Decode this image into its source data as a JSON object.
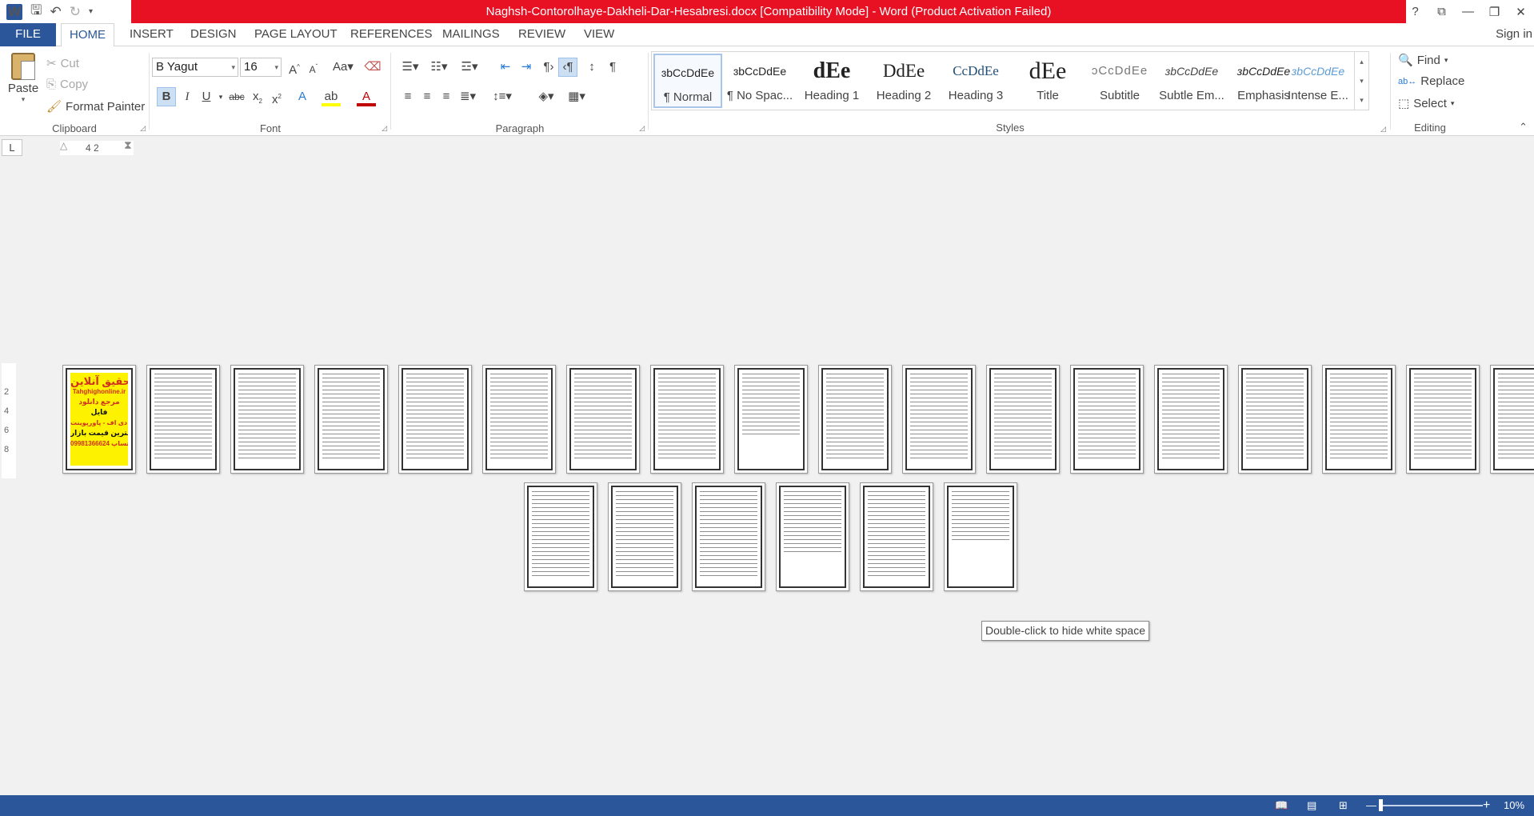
{
  "window": {
    "title": "Naghsh-Contorolhaye-Dakheli-Dar-Hesabresi.docx [Compatibility Mode]  -  Word (Product Activation Failed)",
    "controls": [
      "?",
      "⧉",
      "—",
      "❐",
      "✕"
    ]
  },
  "qat": {
    "app_icon": "W"
  },
  "tabs": [
    "FILE",
    "HOME",
    "INSERT",
    "DESIGN",
    "PAGE LAYOUT",
    "REFERENCES",
    "MAILINGS",
    "REVIEW",
    "VIEW"
  ],
  "active_tab": "HOME",
  "sign_in": "Sign in",
  "clipboard": {
    "paste": "Paste",
    "cut": "Cut",
    "copy": "Copy",
    "format_painter": "Format Painter",
    "label": "Clipboard"
  },
  "font": {
    "name": "B Yagut",
    "size": "16",
    "label": "Font"
  },
  "paragraph": {
    "label": "Paragraph"
  },
  "styles": {
    "label": "Styles",
    "items": [
      {
        "preview": "ɜbCcDdEe",
        "name": "¶ Normal"
      },
      {
        "preview": "ɜbCcDdEe",
        "name": "¶ No Spac..."
      },
      {
        "preview": "dEe",
        "name": "Heading 1"
      },
      {
        "preview": "DdEe",
        "name": "Heading 2"
      },
      {
        "preview": "CcDdEe",
        "name": "Heading 3"
      },
      {
        "preview": "dEe",
        "name": "Title"
      },
      {
        "preview": "ɔCcDdEe",
        "name": "Subtitle"
      },
      {
        "preview": "ɜbCcDdEe",
        "name": "Subtle Em..."
      },
      {
        "preview": "ɜbCcDdEe",
        "name": "Emphasis"
      },
      {
        "preview": "ɜbCcDdEe",
        "name": "Intense E..."
      }
    ]
  },
  "editing": {
    "find": "Find",
    "replace": "Replace",
    "select": "Select",
    "label": "Editing"
  },
  "ruler": {
    "corner": "L",
    "marks": "4   2"
  },
  "vruler": [
    "2",
    "4",
    "6",
    "8"
  ],
  "cover_page": {
    "lines": [
      "تحقیق آنلاین",
      "Tahghighonline.ir",
      "مرجع دانلود",
      "فایل",
      "ورد-پی دی اف - پاورپوینت",
      "با کمترین قیمت بازار",
      "09981366624 واتساپ"
    ]
  },
  "page_count": 24,
  "tooltip": "Double-click to hide white space",
  "status": {
    "zoom": "10%"
  }
}
